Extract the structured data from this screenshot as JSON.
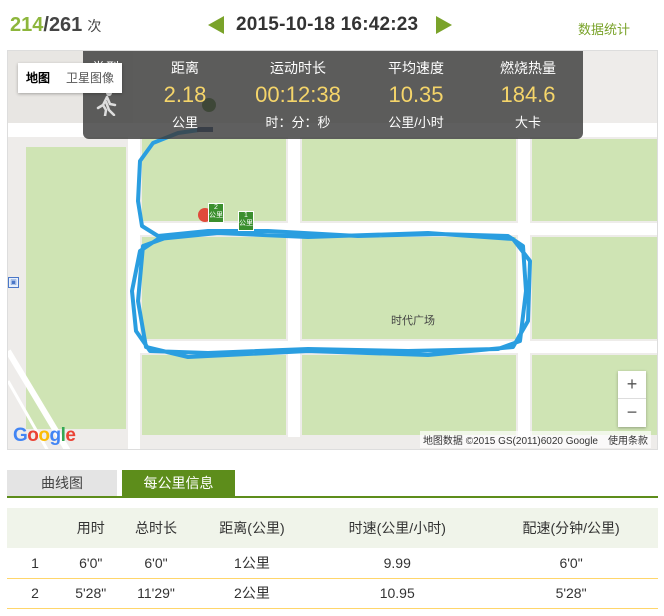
{
  "header": {
    "current": "214",
    "separator": "/",
    "total": "261",
    "unit": "次",
    "datetime": "2015-10-18 16:42:23",
    "stats_link": "数据统计"
  },
  "map": {
    "maptype_map": "地图",
    "maptype_satellite": "卫星图像",
    "place_label": "时代广场",
    "bus_icon": "bus-stop-icon",
    "marker_km_1": "1\n公里",
    "marker_km_2": "2\n公里",
    "zoom_in": "+",
    "zoom_out": "−",
    "attribution": "地图数据 ©2015 GS(2011)6020 Google",
    "terms": "使用条款",
    "route_color": "#2a9ee0"
  },
  "summary": {
    "type_label": "类型",
    "type_icon": "walking-icon",
    "distance_label": "距离",
    "distance_value": "2.18",
    "distance_unit": "公里",
    "duration_label": "运动时长",
    "duration_value": "00:12:38",
    "duration_unit": "时：分：秒",
    "speed_label": "平均速度",
    "speed_value": "10.35",
    "speed_unit": "公里/小时",
    "calorie_label": "燃烧热量",
    "calorie_value": "184.6",
    "calorie_unit": "大卡"
  },
  "tabs": [
    {
      "label": "曲线图",
      "active": false
    },
    {
      "label": "每公里信息",
      "active": true
    }
  ],
  "km_table": {
    "headers": [
      "",
      "用时",
      "总时长",
      "距离(公里)",
      "时速(公里/小时)",
      "配速(分钟/公里)"
    ],
    "rows": [
      [
        "1",
        "6'0\"",
        "6'0\"",
        "1公里",
        "9.99",
        "6'0\""
      ],
      [
        "2",
        "5'28\"",
        "11'29\"",
        "2公里",
        "10.95",
        "5'28\""
      ]
    ]
  },
  "colors": {
    "accent_green": "#5d8d1b",
    "value_yellow": "#f5d56a",
    "counter_green": "#8db63c"
  }
}
